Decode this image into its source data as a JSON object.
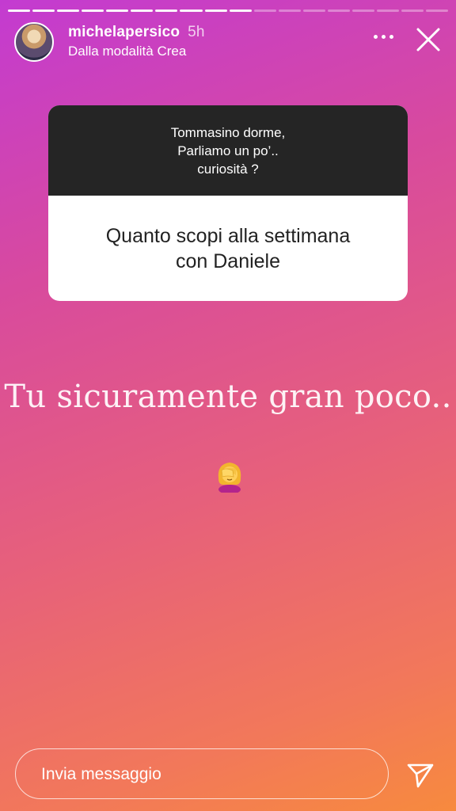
{
  "progress": {
    "total_segments": 18,
    "completed_segments": 10
  },
  "header": {
    "username": "michelapersico",
    "time_ago": "5h",
    "subtitle": "Dalla modalità Crea"
  },
  "question_card": {
    "prompt_lines": [
      "Tommasino dorme,",
      "Parliamo un po’..",
      "curiosità ?"
    ],
    "answer_lines": [
      "Quanto scopi alla settimana",
      "con Daniele"
    ]
  },
  "caption": "Tu sicuramente gran poco..",
  "sticker": "woman-facepalming-emoji",
  "message_input": {
    "placeholder": "Invia messaggio"
  },
  "icons": {
    "more": "more-dots-icon",
    "close": "close-icon",
    "send": "send-icon"
  },
  "colors": {
    "card_top": "#252525",
    "gradient_start": "#c33bd1",
    "gradient_end": "#f78a3e"
  }
}
